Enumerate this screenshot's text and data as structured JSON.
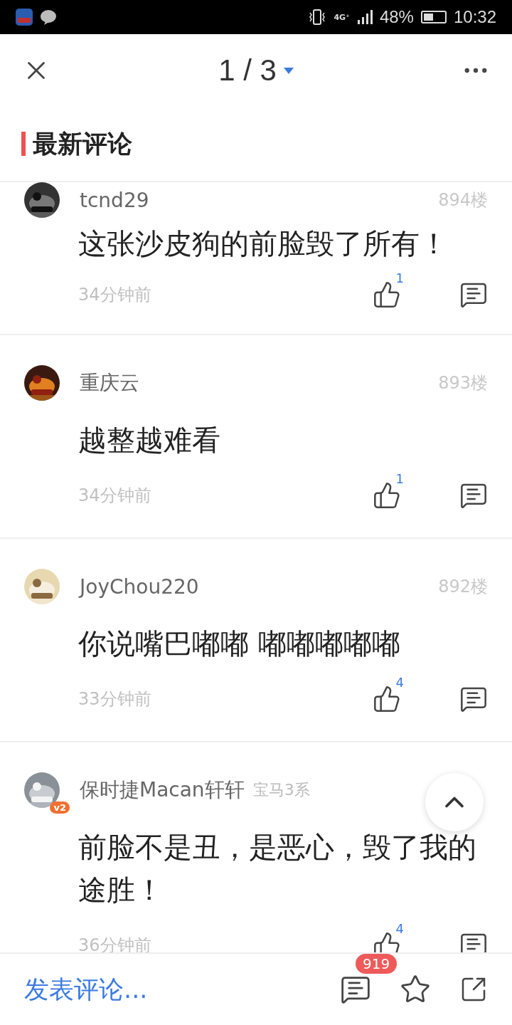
{
  "status_bar": {
    "network": "4G⁺",
    "battery": "48%",
    "time": "10:32"
  },
  "header": {
    "page": "1 / 3"
  },
  "section": {
    "title": "最新评论"
  },
  "comments": [
    {
      "user": "tcnd29",
      "floor": "894楼",
      "text": "这张沙皮狗的前脸毁了所有！",
      "time": "34分钟前",
      "likes": "1"
    },
    {
      "user": "重庆云",
      "floor": "893楼",
      "text": "越整越难看",
      "time": "34分钟前",
      "likes": "1"
    },
    {
      "user": "JoyChou220",
      "floor": "892楼",
      "text": "你说嘴巴嘟嘟 嘟嘟嘟嘟嘟",
      "time": "33分钟前",
      "likes": "4"
    },
    {
      "user": "保时捷Macan轩轩",
      "level": "v2",
      "car": "宝马3系",
      "text": "前脸不是丑，是恶心，毁了我的途胜！",
      "time": "36分钟前",
      "likes": "4"
    }
  ],
  "bottom_bar": {
    "placeholder": "发表评论...",
    "comment_count": "919"
  }
}
